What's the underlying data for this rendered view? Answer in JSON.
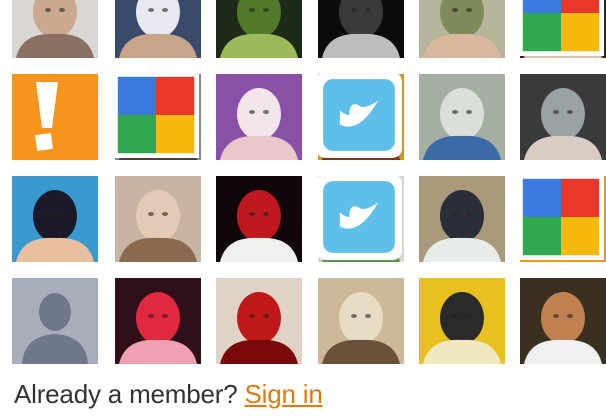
{
  "footer": {
    "prompt": "Already a member?",
    "sign_in_label": "Sign in"
  },
  "colors": {
    "accent": "#e07a10",
    "placeholder_orange": "#f7941d",
    "text": "#333333"
  },
  "avatars": [
    {
      "name": "avatar-member",
      "icon": "photo",
      "badge": "none"
    },
    {
      "name": "avatar-member",
      "icon": "photo",
      "badge": "none"
    },
    {
      "name": "avatar-member",
      "icon": "photo",
      "badge": "none"
    },
    {
      "name": "avatar-member",
      "icon": "photo",
      "badge": "none"
    },
    {
      "name": "avatar-member",
      "icon": "photo",
      "badge": "none"
    },
    {
      "name": "avatar-member",
      "icon": "photo",
      "badge": "google"
    },
    {
      "name": "avatar-placeholder",
      "icon": "exclamation-icon",
      "badge": "none"
    },
    {
      "name": "avatar-member",
      "icon": "photo",
      "badge": "google"
    },
    {
      "name": "avatar-member",
      "icon": "photo",
      "badge": "none"
    },
    {
      "name": "avatar-member",
      "icon": "photo",
      "badge": "twitter"
    },
    {
      "name": "avatar-member",
      "icon": "photo",
      "badge": "none"
    },
    {
      "name": "avatar-member",
      "icon": "photo",
      "badge": "none"
    },
    {
      "name": "avatar-member",
      "icon": "photo",
      "badge": "none"
    },
    {
      "name": "avatar-member",
      "icon": "photo",
      "badge": "none"
    },
    {
      "name": "avatar-member",
      "icon": "photo",
      "badge": "none"
    },
    {
      "name": "avatar-member",
      "icon": "photo",
      "badge": "twitter"
    },
    {
      "name": "avatar-member",
      "icon": "photo",
      "badge": "none"
    },
    {
      "name": "avatar-placeholder",
      "icon": "exclamation-icon",
      "badge": "google"
    },
    {
      "name": "avatar-default",
      "icon": "silhouette-icon",
      "badge": "none"
    },
    {
      "name": "avatar-member",
      "icon": "photo",
      "badge": "none"
    },
    {
      "name": "avatar-member",
      "icon": "photo",
      "badge": "none"
    },
    {
      "name": "avatar-member",
      "icon": "photo",
      "badge": "none"
    },
    {
      "name": "avatar-member",
      "icon": "photo",
      "badge": "none"
    },
    {
      "name": "avatar-member",
      "icon": "photo",
      "badge": "none"
    }
  ]
}
